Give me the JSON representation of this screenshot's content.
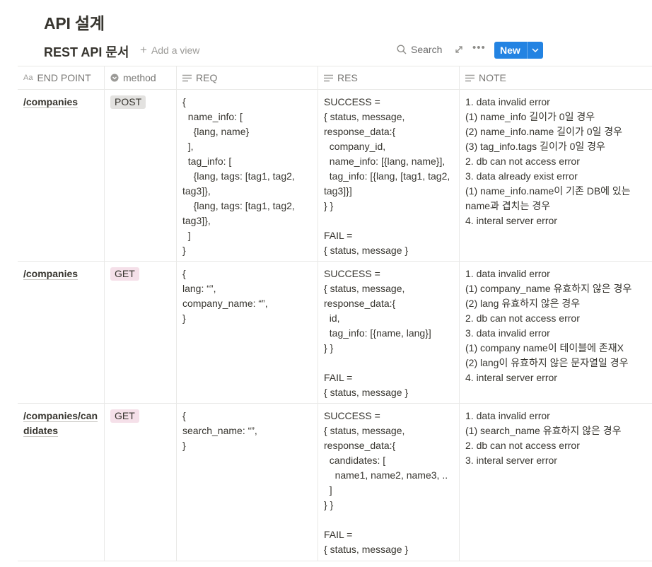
{
  "page": {
    "title": "API 설계"
  },
  "database": {
    "title": "REST API 문서",
    "add_view": "Add a view",
    "search": "Search",
    "new_button": "New"
  },
  "table": {
    "columns": [
      {
        "label": "END POINT",
        "icon": "text-title-icon"
      },
      {
        "label": "method",
        "icon": "select-icon"
      },
      {
        "label": "REQ",
        "icon": "text-lines-icon"
      },
      {
        "label": "RES",
        "icon": "text-lines-icon"
      },
      {
        "label": "NOTE",
        "icon": "text-lines-icon"
      }
    ],
    "rows": [
      {
        "endpoint": "/companies",
        "method": "POST",
        "req": "{\n  name_info: [\n    {lang, name}\n  ],\n  tag_info: [\n    {lang, tags: [tag1, tag2, tag3]},\n    {lang, tags: [tag1, tag2, tag3]},\n  ]\n}",
        "res": "SUCCESS =\n{ status, message, response_data:{\n  company_id,\n  name_info: [{lang, name}],\n  tag_info: [{lang, [tag1, tag2, tag3]}]\n} }\n\nFAIL =\n{ status, message }",
        "note": "1. data invalid error\n(1) name_info 길이가 0일 경우\n(2) name_info.name 길이가 0일 경우\n(3) tag_info.tags 길이가 0일 경우\n2. db can not access error\n3. data already exist error\n(1) name_info.name이 기존 DB에 있는 name과 겹치는 경우\n4. interal server error"
      },
      {
        "endpoint": "/companies",
        "method": "GET",
        "req": "{\nlang: “”,\ncompany_name: “”,\n}",
        "res": "SUCCESS =\n{ status, message, response_data:{\n  id,\n  tag_info: [{name, lang}]\n} }\n\nFAIL =\n{ status, message }",
        "note": "1. data invalid error\n(1) company_name 유효하지 않은 경우\n(2) lang 유효하지 않은 경우\n2. db can not access error\n3. data invalid error\n(1) company name이 테이블에 존재X\n(2) lang이 유효하지 않은 문자열일 경우\n4. interal server error"
      },
      {
        "endpoint": "/companies/candidates",
        "method": "GET",
        "req": "{\nsearch_name: “”,\n}",
        "res": "SUCCESS =\n{ status, message, response_data:{\n  candidates: [\n    name1, name2, name3, ..\n  ]\n} }\n\nFAIL =\n{ status, message }",
        "note": "1. data invalid error\n(1) search_name 유효하지 않은 경우\n2. db can not access error\n3. interal server error"
      }
    ]
  },
  "colors": {
    "accent": "#2383e2",
    "post_tag": "#e3e2e0",
    "get_tag": "#f5e0e9",
    "border": "#e9e9e7"
  }
}
